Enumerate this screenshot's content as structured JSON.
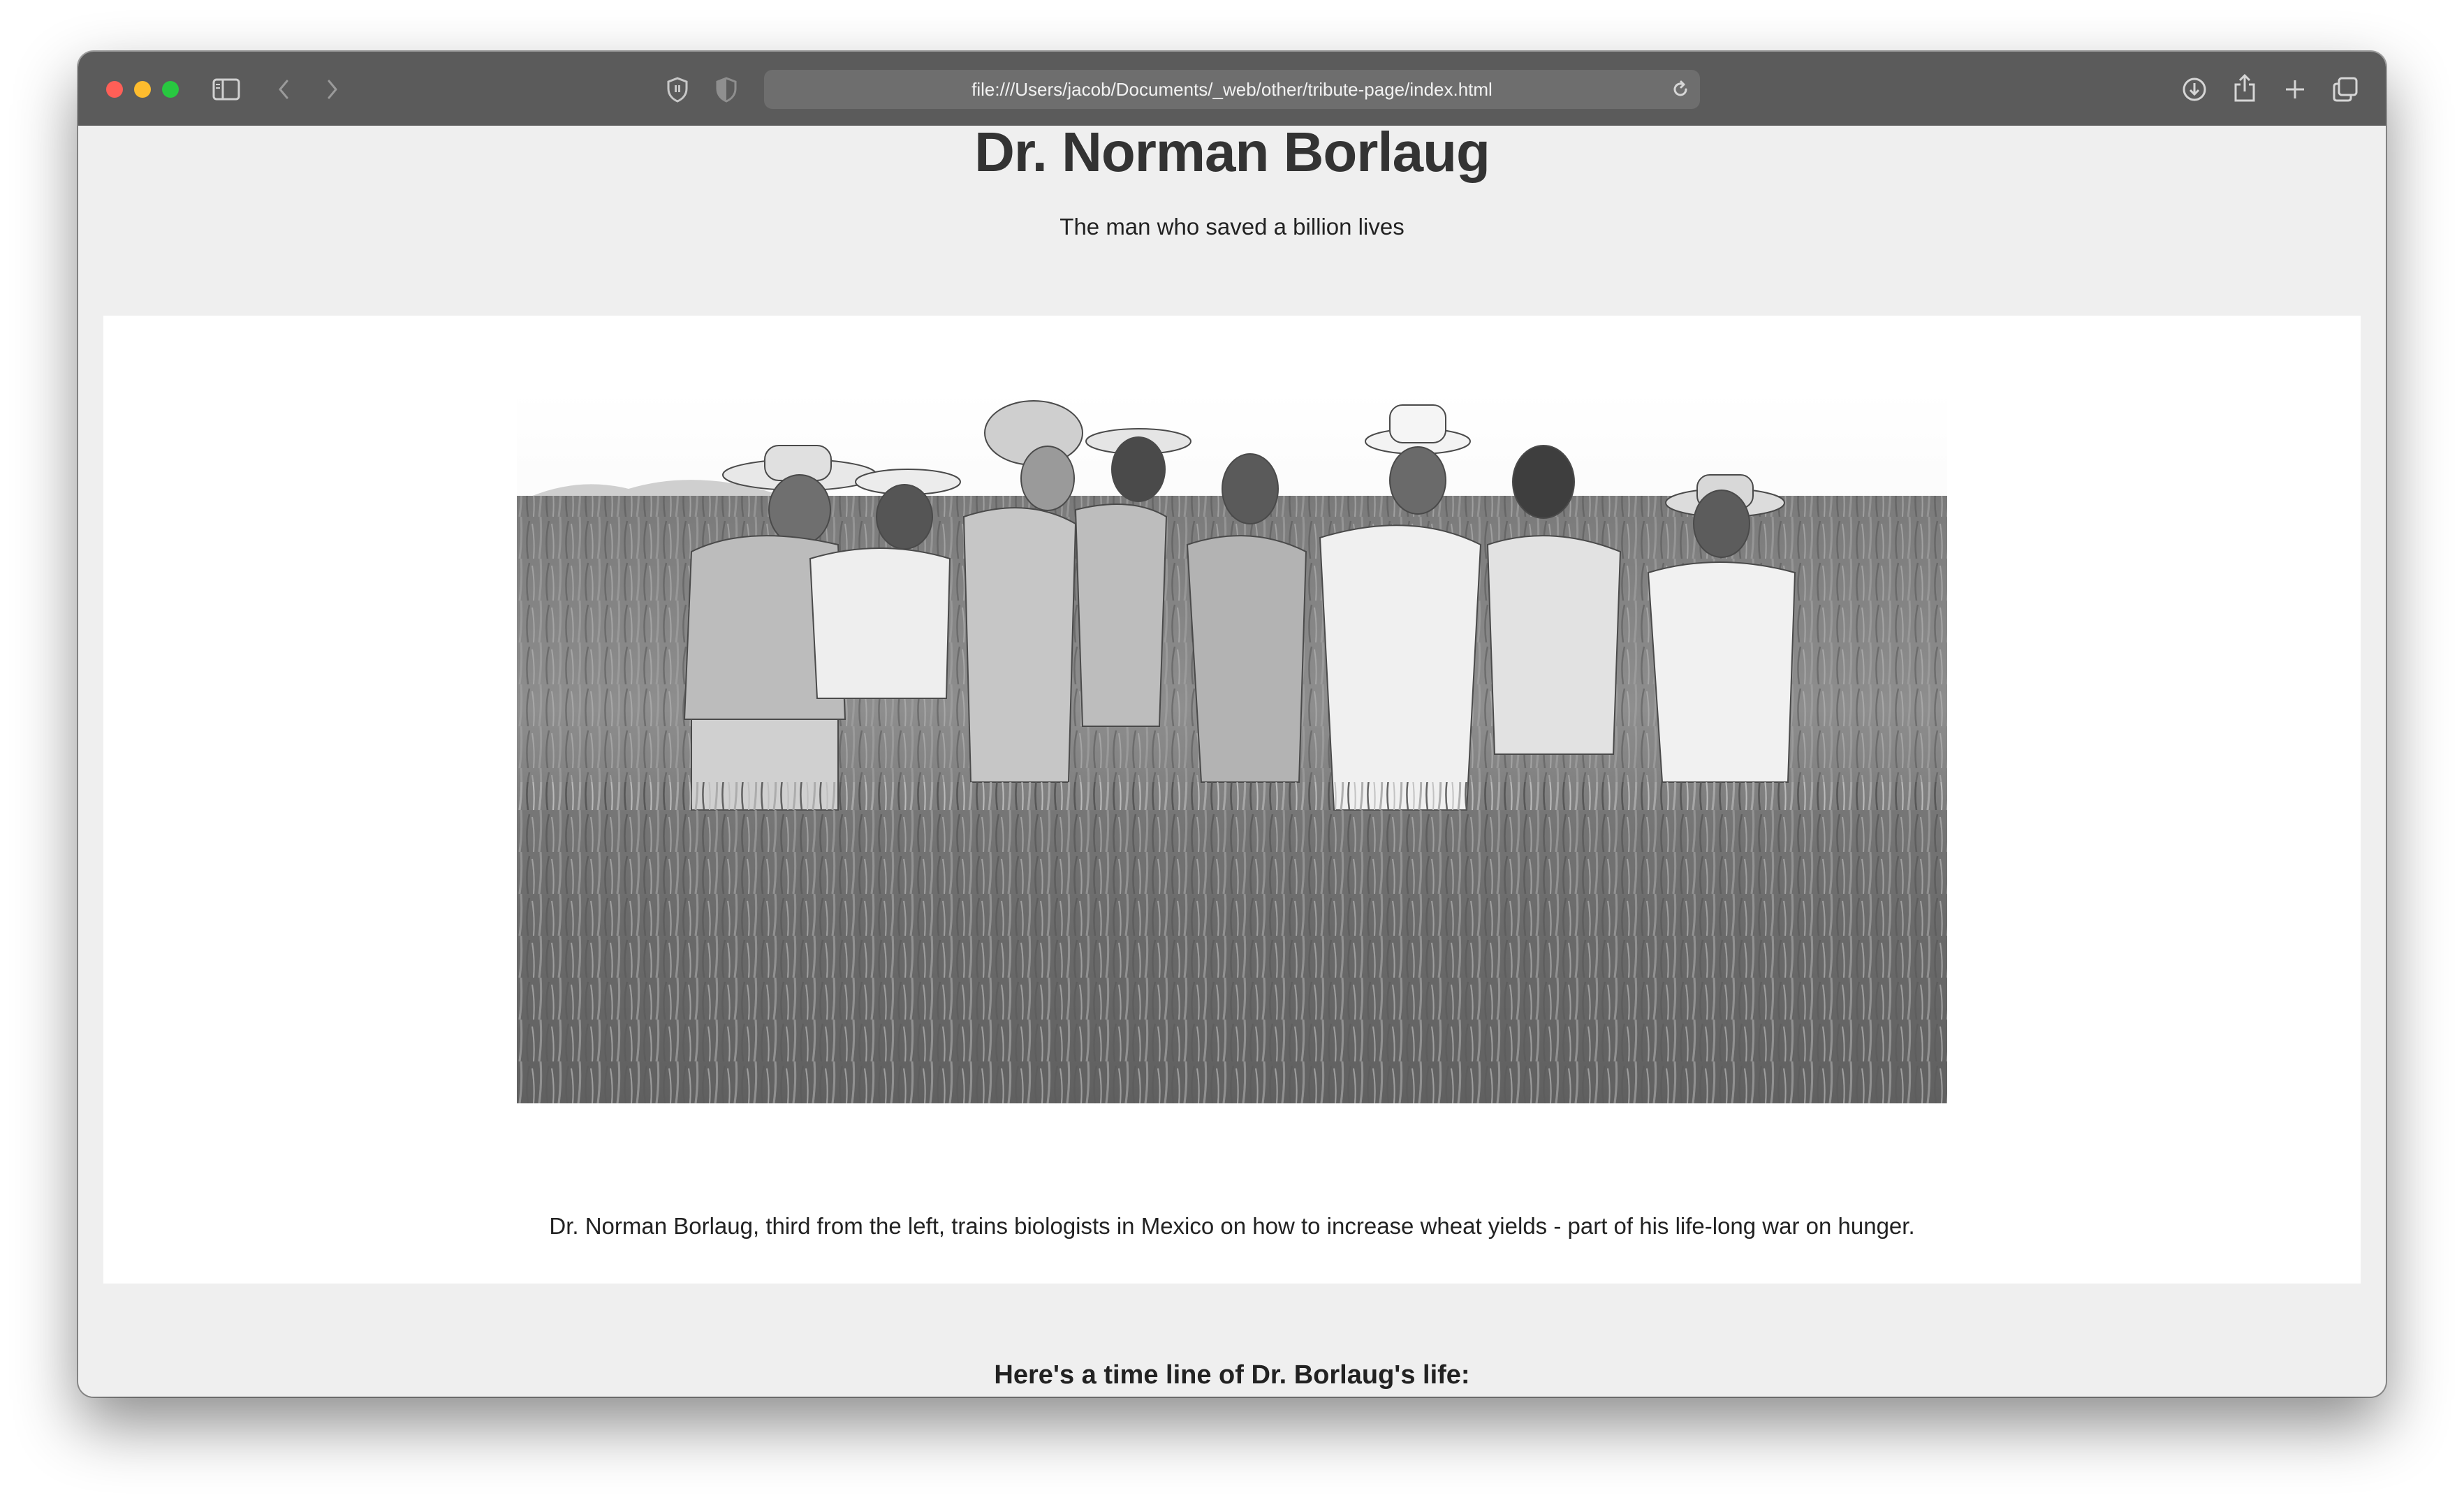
{
  "browser": {
    "url": "file:///Users/jacob/Documents/_web/other/tribute-page/index.html"
  },
  "page": {
    "title": "Dr. Norman Borlaug",
    "subtitle": "The man who saved a billion lives",
    "image_caption": "Dr. Norman Borlaug, third from the left, trains biologists in Mexico on how to increase wheat yields - part of his life-long war on hunger.",
    "timeline_heading": "Here's a time line of Dr. Borlaug's life:"
  },
  "colors": {
    "titlebar": "#5b5b5b",
    "page_background": "#efefef",
    "panel_background": "#ffffff",
    "text_dark": "#333333"
  },
  "icons": {
    "sidebar": "sidebar-icon",
    "back": "chevron-left-icon",
    "forward": "chevron-right-icon",
    "privacy": "shield-icon",
    "reader": "reader-shield-icon",
    "reload": "reload-icon",
    "download": "download-icon",
    "share": "share-icon",
    "new_tab": "plus-icon",
    "tabs": "tabs-overview-icon"
  }
}
